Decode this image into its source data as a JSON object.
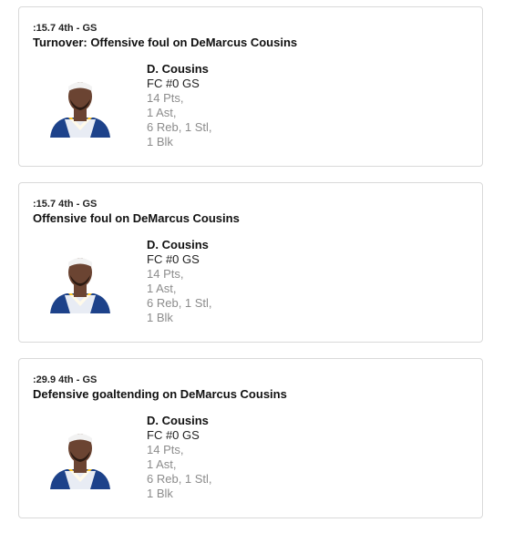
{
  "plays": [
    {
      "clock": ":15.7",
      "period": "4th",
      "team": "GS",
      "description": "Turnover: Offensive foul on DeMarcus Cousins",
      "player": {
        "name": "D. Cousins",
        "position_number": "FC #0 GS",
        "stats": [
          "14 Pts,",
          "1 Ast,",
          "6 Reb, 1 Stl,",
          "1 Blk"
        ]
      }
    },
    {
      "clock": ":15.7",
      "period": "4th",
      "team": "GS",
      "description": "Offensive foul on DeMarcus Cousins",
      "player": {
        "name": "D. Cousins",
        "position_number": "FC #0 GS",
        "stats": [
          "14 Pts,",
          "1 Ast,",
          "6 Reb, 1 Stl,",
          "1 Blk"
        ]
      }
    },
    {
      "clock": ":29.9",
      "period": "4th",
      "team": "GS",
      "description": "Defensive goaltending on DeMarcus Cousins",
      "player": {
        "name": "D. Cousins",
        "position_number": "FC #0 GS",
        "stats": [
          "14 Pts,",
          "1 Ast,",
          "6 Reb, 1 Stl,",
          "1 Blk"
        ]
      }
    }
  ],
  "colors": {
    "border": "#d9d9d9",
    "stat_gray": "#8c8c8c",
    "jersey_blue": "#1d428a",
    "jersey_gold": "#ffc72c",
    "skin": "#6b4432",
    "headband": "#f2f2f2"
  }
}
